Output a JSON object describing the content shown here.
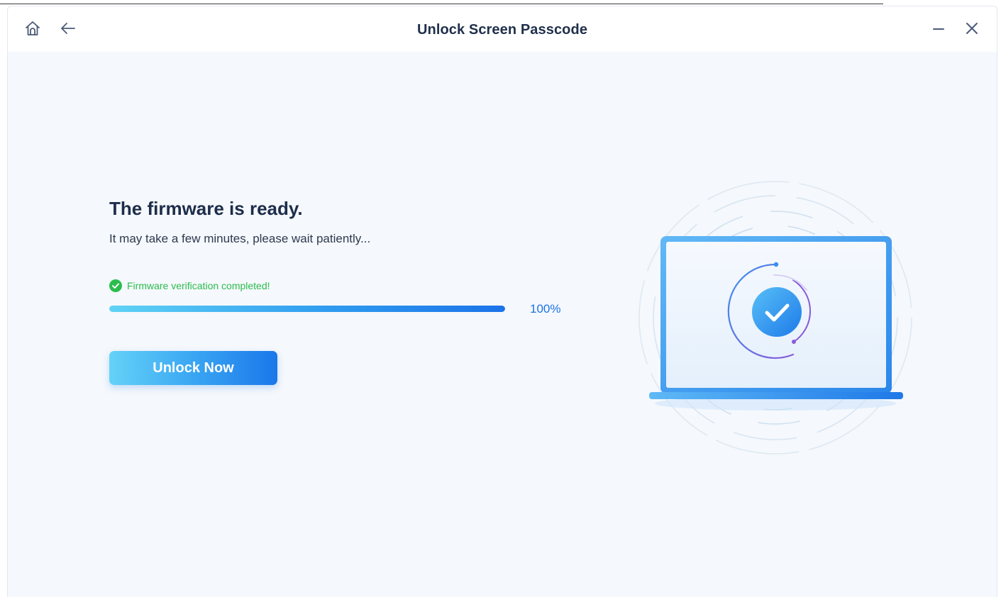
{
  "window": {
    "title": "Unlock Screen Passcode"
  },
  "titlebar": {
    "home_icon": "home-icon",
    "back_icon": "arrow-left-icon",
    "minimize_icon": "minimize-icon",
    "close_icon": "close-icon"
  },
  "main": {
    "headline": "The firmware is ready.",
    "subtext": "It may take a few minutes, please wait patiently...",
    "status": {
      "icon": "check-circle-icon",
      "text": "Firmware verification completed!",
      "color": "#2bbd4e"
    },
    "progress": {
      "value": 100,
      "label": "100%",
      "color": "#1b73e8"
    },
    "unlock_button_label": "Unlock Now"
  },
  "illustration": {
    "icon": "laptop-check-icon",
    "accent_color": "#2f8ff0"
  }
}
